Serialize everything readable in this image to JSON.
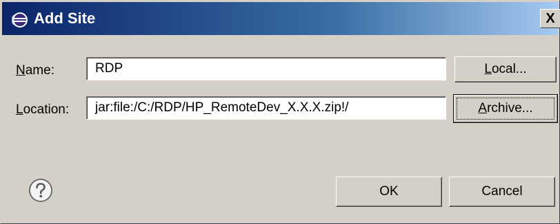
{
  "window": {
    "title": "Add Site",
    "close_glyph": "X"
  },
  "form": {
    "name_label_mnemonic": "N",
    "name_label_rest": "ame:",
    "name_value": "RDP",
    "location_label_mnemonic": "L",
    "location_label_rest": "ocation:",
    "location_value": "jar:file:/C:/RDP/HP_RemoteDev_X.X.X.zip!/"
  },
  "buttons": {
    "local_mnemonic": "L",
    "local_rest": "ocal...",
    "archive_mnemonic": "A",
    "archive_rest": "rchive...",
    "ok": "OK",
    "cancel": "Cancel"
  },
  "icons": {
    "title_icon": "eclipse-icon",
    "help_icon": "help-icon"
  },
  "colors": {
    "title_gradient_start": "#0a246a",
    "title_gradient_end": "#a6caf0",
    "dialog_bg": "#d4d0c8"
  }
}
